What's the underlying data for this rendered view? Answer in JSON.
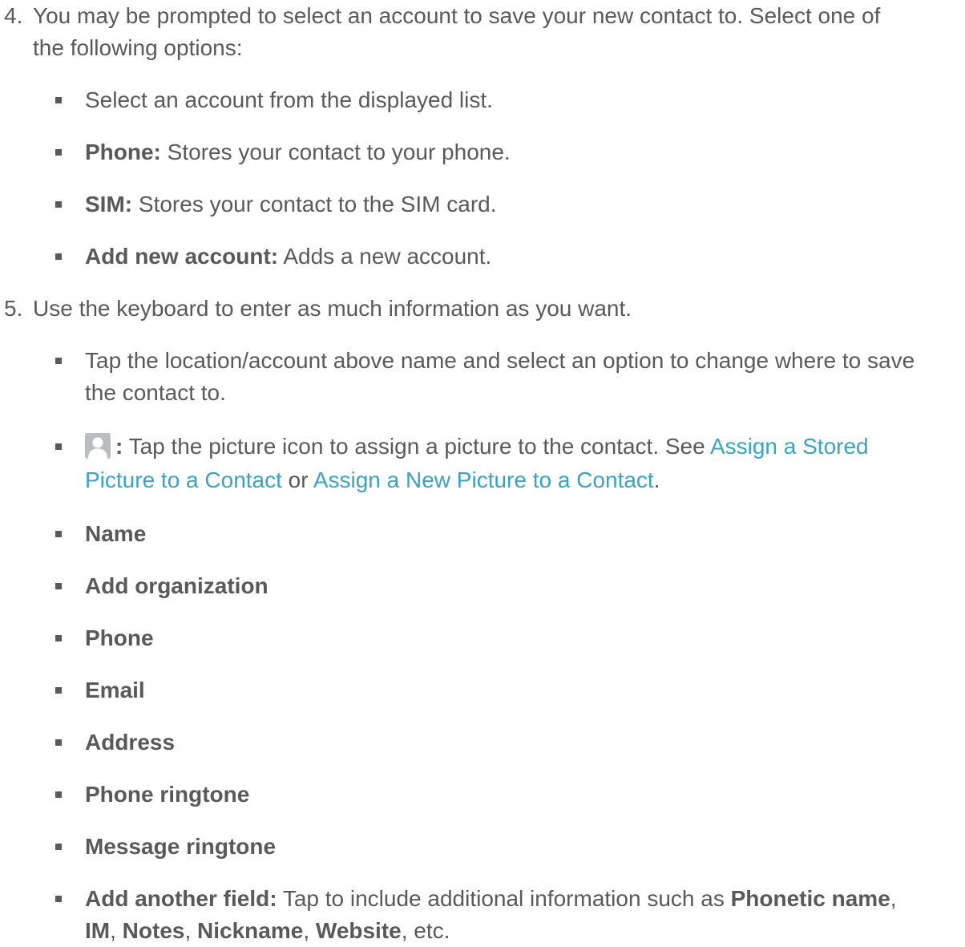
{
  "step4": {
    "number": "4.",
    "line1": "You may be prompted to select an account to save your new contact to. Select one of",
    "line2": "the following options:",
    "options": [
      {
        "bold": "",
        "text": "Select an account from the displayed list."
      },
      {
        "bold": "Phone:",
        "text": " Stores your contact to your phone."
      },
      {
        "bold": "SIM:",
        "text": " Stores your contact to the SIM card."
      },
      {
        "bold": "Add new account:",
        "text": " Adds a new account."
      }
    ]
  },
  "step5": {
    "number": "5.",
    "text": "Use the keyboard to enter as much information as you want.",
    "location_line1": "Tap the location/account above name and select an option to change where to save",
    "location_line2": "the contact to.",
    "picture": {
      "icon": "contact-picture-icon",
      "colon": ":",
      "text": " Tap the picture icon to assign a picture to the contact. See ",
      "link1_part1": "Assign a Stored",
      "link1_part2": "Picture to a Contact",
      "or": " or ",
      "link2": "Assign a New Picture to a Contact",
      "period": "."
    },
    "fields": [
      "Name",
      "Add organization",
      "Phone",
      "Email",
      "Address",
      "Phone ringtone",
      "Message ringtone"
    ],
    "another": {
      "bold": "Add another field:",
      "text": " Tap to include additional information such as ",
      "phonetic": "Phonetic name",
      "comma1": ",",
      "im": "IM",
      "comma2": ", ",
      "notes": "Notes",
      "comma3": ", ",
      "nickname": "Nickname",
      "comma4": ", ",
      "website": "Website",
      "etc": ", etc."
    }
  },
  "colors": {
    "text": "#595959",
    "link": "#3aa4c0"
  }
}
